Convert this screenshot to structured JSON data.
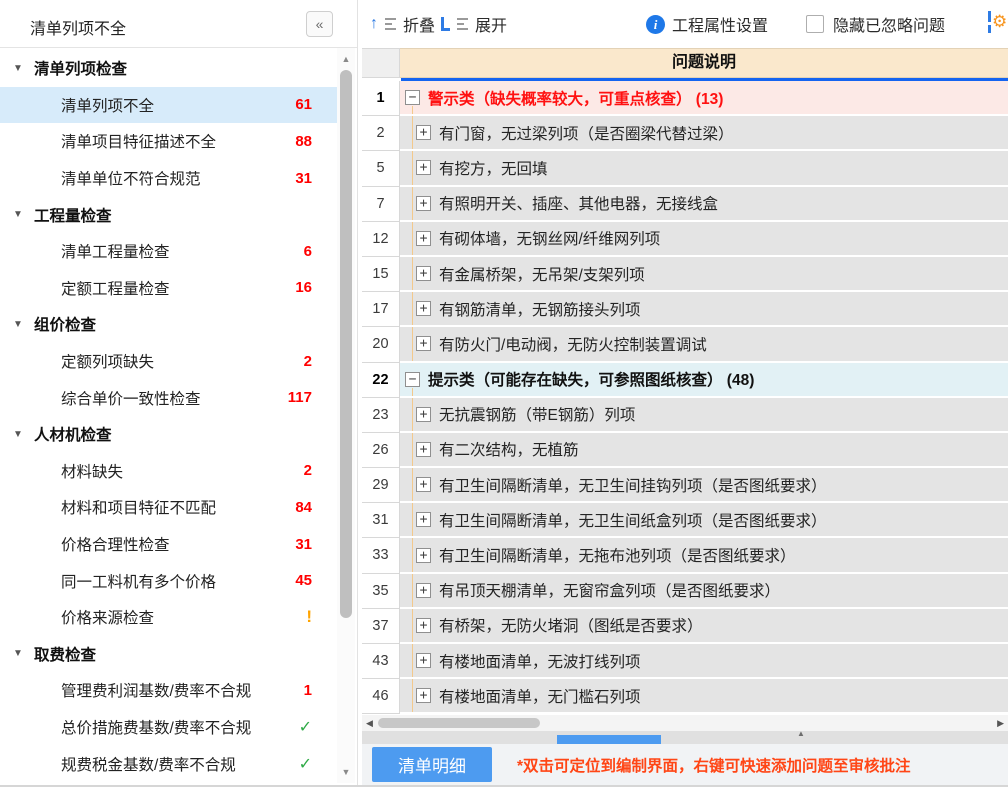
{
  "sidebar": {
    "title": "清单列项不全",
    "collapse_icon": "«",
    "tree": [
      {
        "type": "group",
        "label": "清单列项检查"
      },
      {
        "type": "item",
        "label": "清单列项不全",
        "badge": "61",
        "badge_style": "red",
        "selected": true
      },
      {
        "type": "item",
        "label": "清单项目特征描述不全",
        "badge": "88",
        "badge_style": "red"
      },
      {
        "type": "item",
        "label": "清单单位不符合规范",
        "badge": "31",
        "badge_style": "red"
      },
      {
        "type": "group",
        "label": "工程量检查"
      },
      {
        "type": "item",
        "label": "清单工程量检查",
        "badge": "6",
        "badge_style": "red"
      },
      {
        "type": "item",
        "label": "定额工程量检查",
        "badge": "16",
        "badge_style": "red"
      },
      {
        "type": "group",
        "label": "组价检查"
      },
      {
        "type": "item",
        "label": "定额列项缺失",
        "badge": "2",
        "badge_style": "red"
      },
      {
        "type": "item",
        "label": "综合单价一致性检查",
        "badge": "117",
        "badge_style": "red"
      },
      {
        "type": "group",
        "label": "人材机检查"
      },
      {
        "type": "item",
        "label": "材料缺失",
        "badge": "2",
        "badge_style": "red"
      },
      {
        "type": "item",
        "label": "材料和项目特征不匹配",
        "badge": "84",
        "badge_style": "red"
      },
      {
        "type": "item",
        "label": "价格合理性检查",
        "badge": "31",
        "badge_style": "red"
      },
      {
        "type": "item",
        "label": "同一工料机有多个价格",
        "badge": "45",
        "badge_style": "red"
      },
      {
        "type": "item",
        "label": "价格来源检查",
        "badge": "!",
        "badge_style": "orange"
      },
      {
        "type": "group",
        "label": "取费检查"
      },
      {
        "type": "item",
        "label": "管理费利润基数/费率不合规",
        "badge": "1",
        "badge_style": "red"
      },
      {
        "type": "item",
        "label": "总价措施费基数/费率不合规",
        "badge": "✓",
        "badge_style": "green"
      },
      {
        "type": "item",
        "label": "规费税金基数/费率不合规",
        "badge": "✓",
        "badge_style": "green"
      }
    ]
  },
  "toolbar": {
    "collapse_label": "折叠",
    "expand_label": "展开",
    "property_label": "工程属性设置",
    "hide_ignored_label": "隐藏已忽略问题",
    "hide_ignored_checked": false
  },
  "table": {
    "header": "问题说明",
    "rows": [
      {
        "num": "1",
        "kind": "warn",
        "expand": "minus",
        "text": "警示类（缺失概率较大，可重点核查）  (13)"
      },
      {
        "num": "2",
        "kind": "child",
        "expand": "plus",
        "text": "有门窗，无过梁列项（是否圈梁代替过梁）"
      },
      {
        "num": "5",
        "kind": "child",
        "expand": "plus",
        "text": "有挖方，无回填"
      },
      {
        "num": "7",
        "kind": "child",
        "expand": "plus",
        "text": "有照明开关、插座、其他电器，无接线盒"
      },
      {
        "num": "12",
        "kind": "child",
        "expand": "plus",
        "text": "有砌体墙，无钢丝网/纤维网列项"
      },
      {
        "num": "15",
        "kind": "child",
        "expand": "plus",
        "text": "有金属桥架，无吊架/支架列项"
      },
      {
        "num": "17",
        "kind": "child",
        "expand": "plus",
        "text": "有钢筋清单，无钢筋接头列项"
      },
      {
        "num": "20",
        "kind": "child",
        "expand": "plus",
        "text": "有防火门/电动阀，无防火控制装置调试"
      },
      {
        "num": "22",
        "kind": "tip",
        "expand": "minus",
        "text": "提示类（可能存在缺失，可参照图纸核查）  (48)"
      },
      {
        "num": "23",
        "kind": "child",
        "expand": "plus",
        "text": "无抗震钢筋（带E钢筋）列项"
      },
      {
        "num": "26",
        "kind": "child",
        "expand": "plus",
        "text": "有二次结构，无植筋"
      },
      {
        "num": "29",
        "kind": "child",
        "expand": "plus",
        "text": "有卫生间隔断清单，无卫生间挂钩列项（是否图纸要求）"
      },
      {
        "num": "31",
        "kind": "child",
        "expand": "plus",
        "text": "有卫生间隔断清单，无卫生间纸盒列项（是否图纸要求）"
      },
      {
        "num": "33",
        "kind": "child",
        "expand": "plus",
        "text": "有卫生间隔断清单，无拖布池列项（是否图纸要求）"
      },
      {
        "num": "35",
        "kind": "child",
        "expand": "plus",
        "text": "有吊顶天棚清单，无窗帘盒列项（是否图纸要求）"
      },
      {
        "num": "37",
        "kind": "child",
        "expand": "plus",
        "text": "有桥架，无防火堵洞（图纸是否要求）"
      },
      {
        "num": "43",
        "kind": "child",
        "expand": "plus",
        "text": "有楼地面清单，无波打线列项"
      },
      {
        "num": "46",
        "kind": "child",
        "expand": "plus",
        "text": "有楼地面清单，无门槛石列项"
      }
    ]
  },
  "footer": {
    "tab_label": "清单明细",
    "notice": "*双击可定位到编制界面，右键可快速添加问题至审核批注"
  },
  "colors": {
    "accent_blue": "#1e78e8",
    "header_underline": "#1464f0",
    "warn_row_bg": "#fce9e6",
    "warn_text": "#ff1111",
    "tip_row_bg": "#e2f1f5",
    "child_row_bg": "#e4e4e4",
    "column_header_bg": "#fae8cc",
    "selected_item_bg": "#d7ebfa",
    "badge_red": "#ff0000",
    "badge_orange": "#ffa400",
    "badge_green": "#2eaa46",
    "footer_notice": "#ff4616",
    "button_blue": "#4d9bf0",
    "tree_guide_orange": "#f3c98c"
  }
}
